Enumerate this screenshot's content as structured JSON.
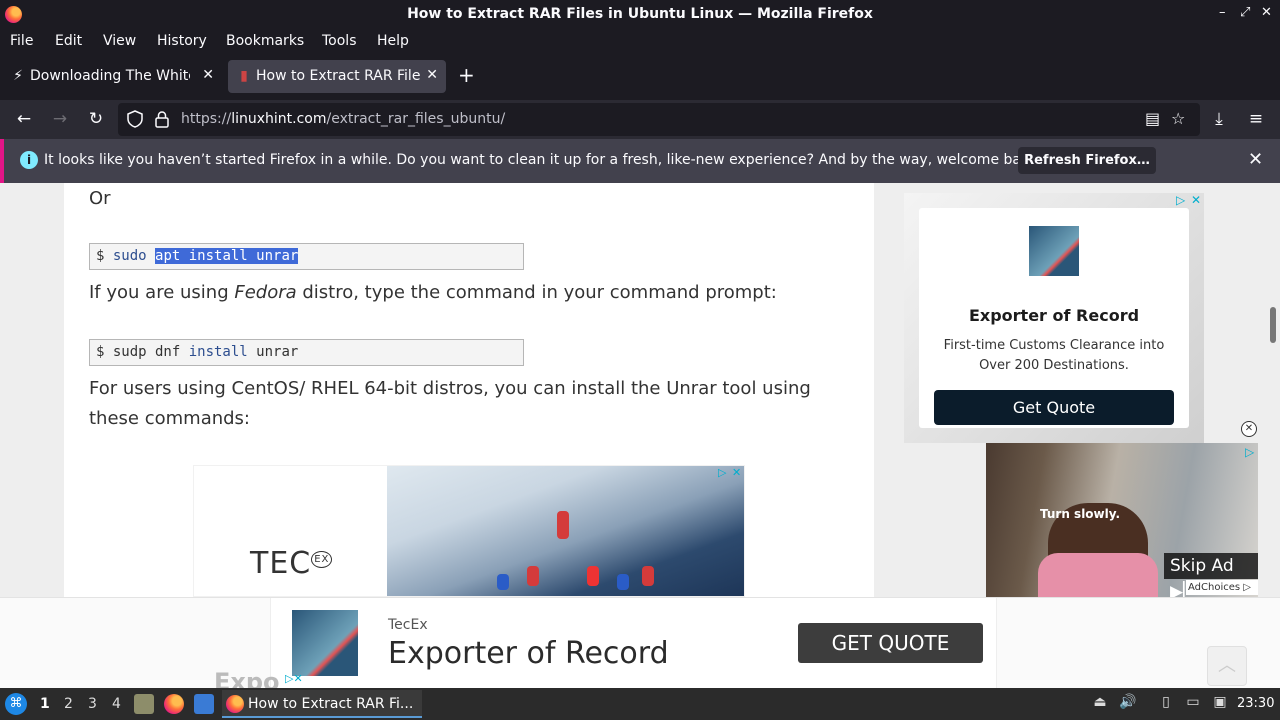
{
  "window": {
    "title": "How to Extract RAR Files in Ubuntu Linux — Mozilla Firefox",
    "controls": [
      "–",
      "⤢",
      "✕"
    ]
  },
  "menu": [
    "File",
    "Edit",
    "View",
    "History",
    "Bookmarks",
    "Tools",
    "Help"
  ],
  "tabs": [
    {
      "label": "Downloading The White House",
      "active": false
    },
    {
      "label": "How to Extract RAR Files in Ubuntu Linux",
      "active": true
    }
  ],
  "newtab": "+",
  "url": {
    "prefix": "https://",
    "domain": "linuxhint.com",
    "path": "/extract_rar_files_ubuntu/"
  },
  "notification": {
    "info": "i",
    "message": "It looks like you haven’t started Firefox in a while. Do you want to clean it up for a fresh, like-new experience? And by the way, welcome back!",
    "button": "Refresh Firefox…",
    "close": "✕"
  },
  "article": {
    "or": "Or",
    "code1": {
      "prompt": "$ ",
      "cmd": "sudo ",
      "selected": "apt install unrar"
    },
    "fedora_pre": "If you are using ",
    "fedora_em": "Fedora",
    "fedora_post": " distro, type the command in your command prompt:",
    "code2": {
      "prompt": "$ ",
      "cmd": "sudp dnf ",
      "kw": "install",
      "rest": " unrar"
    },
    "centos": "For users using CentOS/ RHEL 64-bit distros, you can install the Unrar tool using these commands:"
  },
  "inline_ad": {
    "logo": "TEC",
    "logo_sup": "EX",
    "ad_marks": [
      "▷",
      "✕"
    ]
  },
  "side_ad": {
    "title": "Exporter of Record",
    "body": "First-time Customs Clearance into Over 200 Destinations.",
    "button": "Get Quote",
    "ad_marks": [
      "▷",
      "✕"
    ]
  },
  "video_ad": {
    "caption": "Turn slowly.",
    "skip": "Skip Ad ▶▏",
    "adchoices": "AdChoices ▷",
    "close": "✕",
    "corner": "▷"
  },
  "sticky_ad": {
    "brand": "TecEx",
    "headline": "Exporter of Record",
    "button": "GET QUOTE",
    "ghost": "Expo",
    "ad_marks": "▷✕",
    "totop": "︿"
  },
  "taskbar": {
    "workspaces": [
      "1",
      "2",
      "3",
      "4"
    ],
    "task_title": "How to Extract RAR Fi...",
    "clock": "23:30"
  },
  "colors": {
    "accent": "#e31587",
    "selection": "#3f6ad8",
    "adlink": "#00aecd"
  }
}
